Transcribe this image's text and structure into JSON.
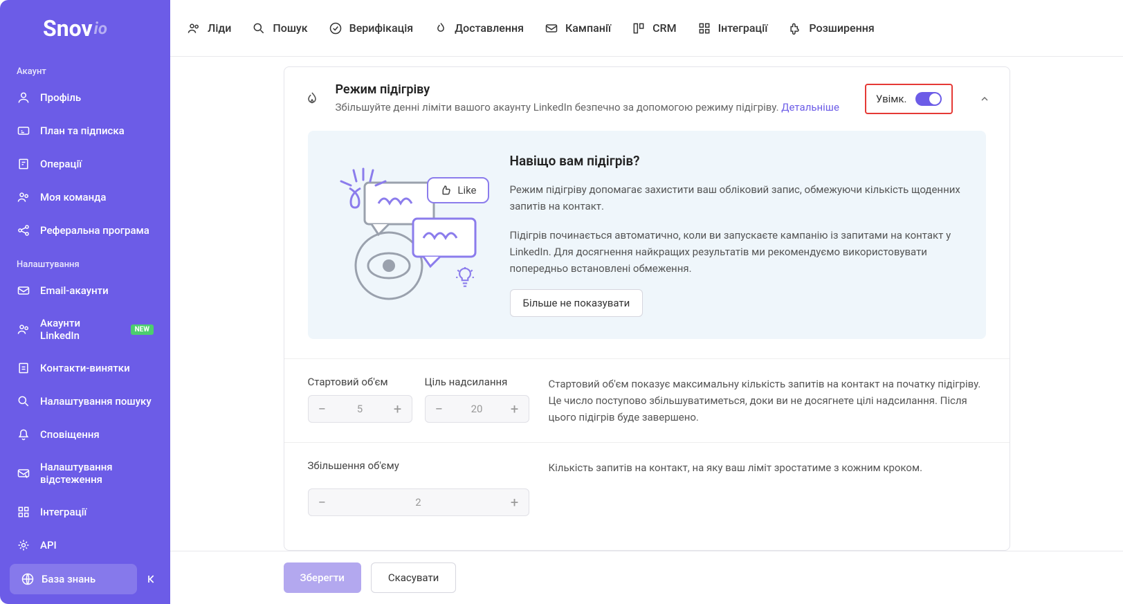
{
  "logo": "Snov",
  "logo_suffix": "io",
  "sidebar": {
    "sections": [
      {
        "title": "Акаунт",
        "items": [
          {
            "label": "Профіль",
            "icon": "user"
          },
          {
            "label": "План та підписка",
            "icon": "card"
          },
          {
            "label": "Операції",
            "icon": "receipt"
          },
          {
            "label": "Моя команда",
            "icon": "team"
          },
          {
            "label": "Реферальна програма",
            "icon": "share"
          }
        ]
      },
      {
        "title": "Налаштування",
        "items": [
          {
            "label": "Email-акаунти",
            "icon": "mail"
          },
          {
            "label": "Акаунти LinkedIn",
            "icon": "team",
            "badge": "NEW"
          },
          {
            "label": "Контакти-винятки",
            "icon": "doc"
          },
          {
            "label": "Налаштування пошуку",
            "icon": "search"
          },
          {
            "label": "Сповіщення",
            "icon": "bell"
          },
          {
            "label": "Налаштування відстеження",
            "icon": "mail2"
          },
          {
            "label": "Інтеграції",
            "icon": "grid"
          },
          {
            "label": "API",
            "icon": "api"
          }
        ]
      }
    ],
    "kb": "База знань"
  },
  "topnav": [
    {
      "label": "Ліди"
    },
    {
      "label": "Пошук"
    },
    {
      "label": "Верифікація"
    },
    {
      "label": "Доставлення"
    },
    {
      "label": "Кампанії"
    },
    {
      "label": "CRM"
    },
    {
      "label": "Інтеграції"
    },
    {
      "label": "Розширення"
    }
  ],
  "card": {
    "title": "Режим підігріву",
    "subtitle_text": "Збільшуйте денні ліміти вашого акаунту LinkedIn безпечно за допомогою режиму підігріву. ",
    "subtitle_link": "Детальніше",
    "toggle_label": "Увімк."
  },
  "info": {
    "like": "Like",
    "title": "Навіщо вам підігрів?",
    "p1": "Режим підігріву допомагає захистити ваш обліковий запис, обмежуючи кількість щоденних запитів на контакт.",
    "p2": "Підігрів починається автоматично, коли ви запускаєте кампанію із запитами на контакт у LinkedIn. Для досягнення найкращих результатів ми рекомендуємо використовувати попередньо встановлені обмеження.",
    "dismiss": "Більше не показувати"
  },
  "rows": {
    "start": {
      "label": "Стартовий об'єм",
      "value": "5"
    },
    "target": {
      "label": "Ціль надсилання",
      "value": "20"
    },
    "limits_desc": "Стартовий об'єм показує максимальну кількість запитів на контакт на початку підігріву. Це число поступово збільшуватиметься, доки ви не досягнете цілі надсилання. Після цього підігрів буде завершено.",
    "increase": {
      "label": "Збільшення об'єму",
      "value": "2"
    },
    "increase_desc": "Кількість запитів на контакт, на яку ваш ліміт зростатиме з кожним кроком."
  },
  "buttons": {
    "save": "Зберегти",
    "cancel": "Скасувати"
  }
}
